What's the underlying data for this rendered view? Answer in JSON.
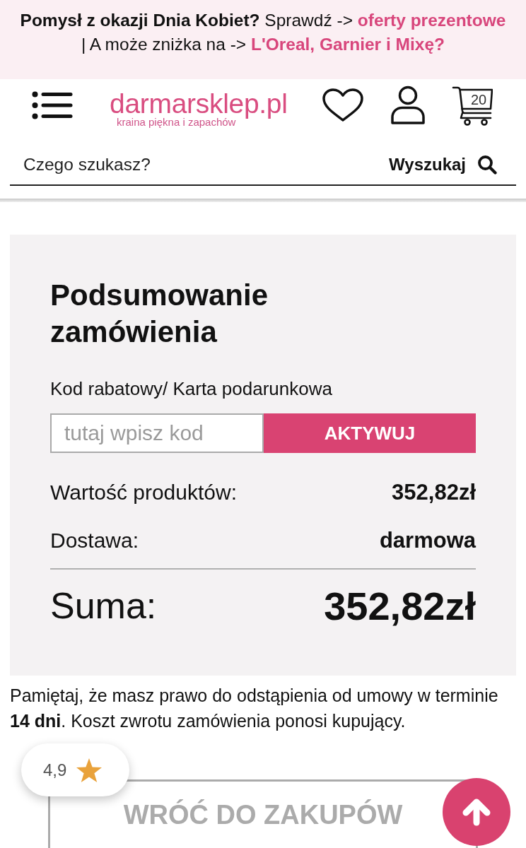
{
  "promo_banner": {
    "parts": [
      {
        "kind": "text",
        "text": "**Pomysł z okazji Dnia Kobiet?** Sprawdź -> "
      },
      {
        "kind": "link",
        "text": "oferty prezentowe"
      },
      {
        "kind": "text",
        "text": " | A może zniżka na -> "
      },
      {
        "kind": "link",
        "text": "L'Oreal, Garnier i Mixę?"
      }
    ]
  },
  "header": {
    "logo": "darmarsklep.pl",
    "tagline": "kraina piękna i zapachów",
    "cart_count": "20"
  },
  "search": {
    "placeholder": "Czego szukasz?",
    "button": "Wyszukaj"
  },
  "order_summary": {
    "title": "Podsumowanie zamówienia",
    "discount": {
      "label": "Kod rabatowy/ Karta podarunkowa",
      "placeholder": "tutaj wpisz kod",
      "button": "AKTYWUJ"
    },
    "rows": [
      {
        "label": "Wartość produktów:",
        "value": "352,82zł"
      },
      {
        "label": "Dostawa:",
        "value": "darmowa"
      }
    ],
    "total": {
      "label": "Suma:",
      "value": "352,82zł"
    }
  },
  "notice": "Pamiętaj, że masz prawo do odstąpienia od umowy w terminie **14 dni**. Koszt zwrotu zamówienia ponosi kupujący.",
  "rating_badge": {
    "score": "4,9"
  },
  "back_button": "WRÓĆ DO ZAKUPÓW"
}
